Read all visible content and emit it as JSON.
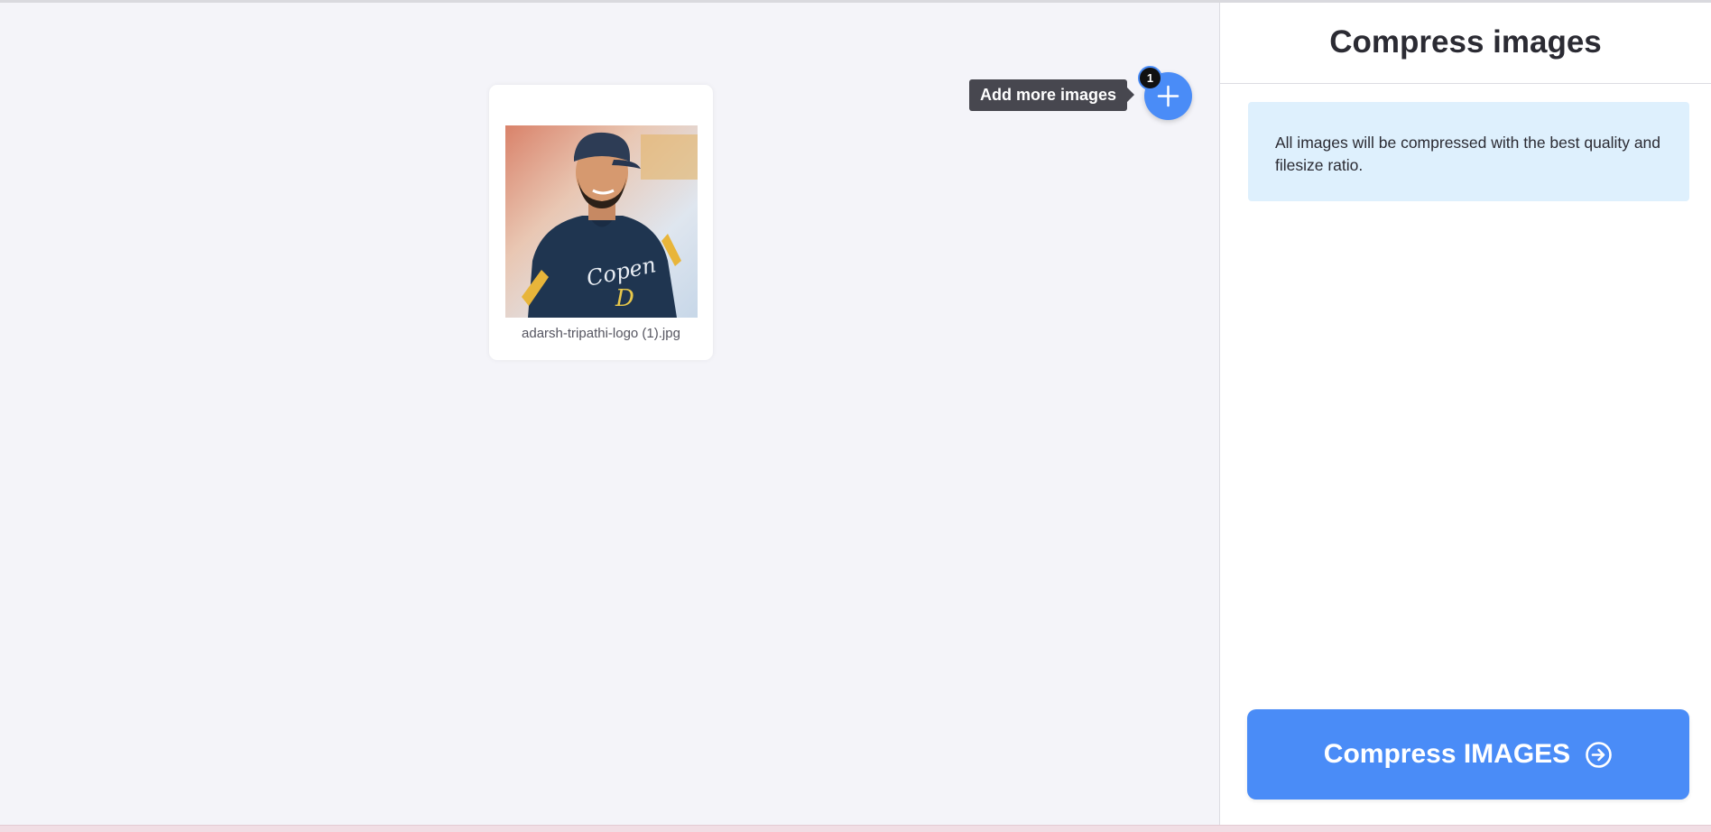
{
  "workspace": {
    "files": [
      {
        "name": "adarsh-tripathi-logo (1).jpg"
      }
    ],
    "add_more": {
      "tooltip": "Add more images",
      "count": "1"
    }
  },
  "sidebar": {
    "title": "Compress images",
    "info": "All images will be compressed with the best quality and filesize ratio.",
    "action_label": "Compress IMAGES"
  },
  "icons": {
    "add": "plus-icon",
    "action": "arrow-right-circle-icon"
  },
  "colors": {
    "accent": "#4a8cf7",
    "info_bg": "#def0fd",
    "tooltip_bg": "#47474f",
    "workspace_bg": "#f4f4f9"
  }
}
